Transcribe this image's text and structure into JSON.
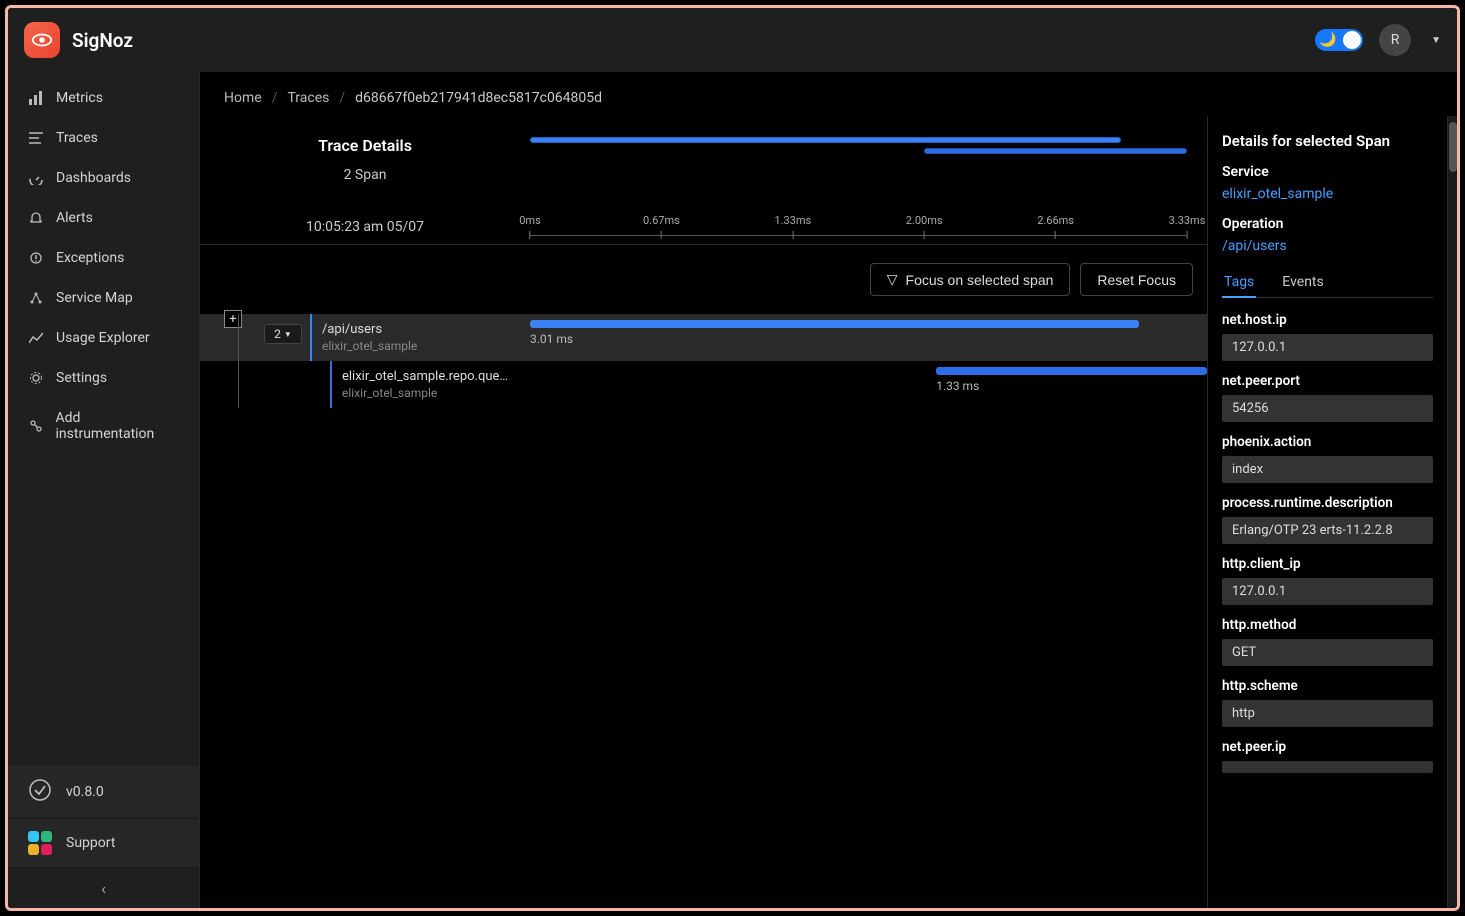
{
  "brand": {
    "title": "SigNoz"
  },
  "avatar": {
    "initial": "R"
  },
  "sidebar": {
    "items": [
      {
        "label": "Metrics"
      },
      {
        "label": "Traces"
      },
      {
        "label": "Dashboards"
      },
      {
        "label": "Alerts"
      },
      {
        "label": "Exceptions"
      },
      {
        "label": "Service Map"
      },
      {
        "label": "Usage Explorer"
      },
      {
        "label": "Settings"
      },
      {
        "label": "Add instrumentation"
      }
    ],
    "version": "v0.8.0",
    "support": "Support"
  },
  "breadcrumbs": {
    "home": "Home",
    "traces": "Traces",
    "id": "d68667f0eb217941d8ec5817c064805d"
  },
  "trace": {
    "title": "Trace Details",
    "spanCount": "2 Span",
    "timestamp": "10:05:23 am 05/07",
    "ticks": [
      "0ms",
      "0.67ms",
      "1.33ms",
      "2.00ms",
      "2.66ms",
      "3.33ms"
    ],
    "focusBtn": "Focus on selected span",
    "resetBtn": "Reset Focus"
  },
  "spans": {
    "row1": {
      "count": "2",
      "op": "/api/users",
      "svc": "elixir_otel_sample",
      "dur": "3.01 ms"
    },
    "row2": {
      "op": "elixir_otel_sample.repo.que…",
      "svc": "elixir_otel_sample",
      "dur": "1.33 ms"
    }
  },
  "details": {
    "title": "Details for selected Span",
    "serviceLabel": "Service",
    "service": "elixir_otel_sample",
    "operationLabel": "Operation",
    "operation": "/api/users",
    "tabs": {
      "tags": "Tags",
      "events": "Events"
    },
    "tags": [
      {
        "k": "net.host.ip",
        "v": "127.0.0.1"
      },
      {
        "k": "net.peer.port",
        "v": "54256"
      },
      {
        "k": "phoenix.action",
        "v": "index"
      },
      {
        "k": "process.runtime.description",
        "v": "Erlang/OTP 23 erts-11.2.2.8"
      },
      {
        "k": "http.client_ip",
        "v": "127.0.0.1"
      },
      {
        "k": "http.method",
        "v": "GET"
      },
      {
        "k": "http.scheme",
        "v": "http"
      },
      {
        "k": "net.peer.ip",
        "v": ""
      }
    ]
  }
}
